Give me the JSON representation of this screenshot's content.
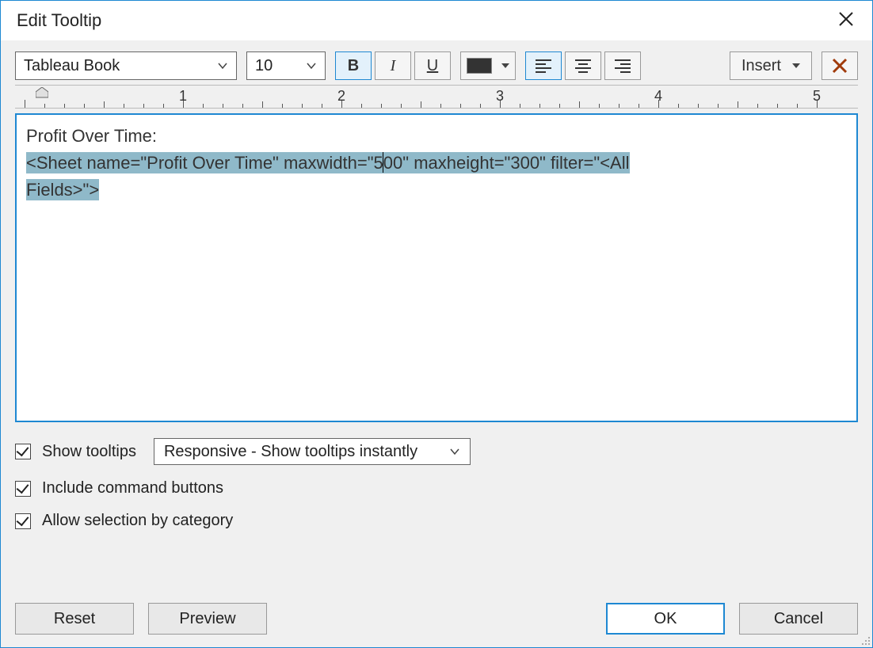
{
  "window": {
    "title": "Edit Tooltip"
  },
  "toolbar": {
    "font_family": "Tableau Book",
    "font_size": "10",
    "bold": "B",
    "italic": "I",
    "underline": "U",
    "color": "#333333",
    "insert_label": "Insert"
  },
  "ruler": {
    "labels": [
      "1",
      "2",
      "3",
      "4",
      "5"
    ]
  },
  "editor": {
    "line1": "Profit Over Time:",
    "line2_pre": "<Sheet name=\"Profit Over Time\" maxwidth=\"5",
    "line2_post": "00\" maxheight=\"300\" filter=\"<All ",
    "line3": "Fields>\">"
  },
  "options": {
    "show_tooltips_label": "Show tooltips",
    "behavior_selected": "Responsive - Show tooltips instantly",
    "include_command_buttons_label": "Include command buttons",
    "allow_selection_label": "Allow selection by category"
  },
  "buttons": {
    "reset": "Reset",
    "preview": "Preview",
    "ok": "OK",
    "cancel": "Cancel"
  }
}
